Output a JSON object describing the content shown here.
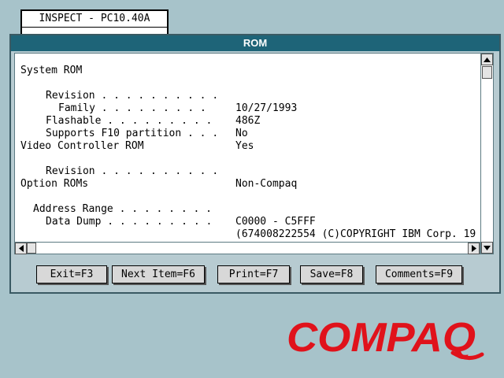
{
  "background_window": {
    "title": "INSPECT - PC10.40A"
  },
  "dialog": {
    "title": "ROM",
    "sections": [
      {
        "heading": "System ROM",
        "rows": [
          {
            "label": "Revision . . . . . . . . . .",
            "value": "10/27/1993"
          },
          {
            "label": "Family . . . . . . . . .",
            "value": "486Z"
          },
          {
            "label": "Flashable . . . . . . . . .",
            "value": "No"
          },
          {
            "label": "Supports F10 partition . . .",
            "value": "Yes"
          }
        ]
      },
      {
        "heading": "Video Controller ROM",
        "rows": [
          {
            "label": "Revision . . . . . . . . . .",
            "value": "Non-Compaq"
          }
        ]
      },
      {
        "heading": "Option ROMs",
        "rows": [
          {
            "label": "Address Range . . . . . . . .",
            "value": "C0000 - C5FFF"
          },
          {
            "label": "Data Dump . . . . . . . . .",
            "value": "(674008222554 (C)COPYRIGHT IBM Corp. 19"
          }
        ]
      }
    ],
    "buttons": {
      "exit": "Exit=F3",
      "next_item": "Next Item=F6",
      "print": "Print=F7",
      "save": "Save=F8",
      "comments": "Comments=F9"
    }
  },
  "logo": {
    "text": "COMPAQ"
  },
  "colors": {
    "desktop": "#a7c3ca",
    "title_bar": "#1e6478",
    "dialog_bg": "#b7cbd1",
    "logo_red": "#e0121b"
  }
}
